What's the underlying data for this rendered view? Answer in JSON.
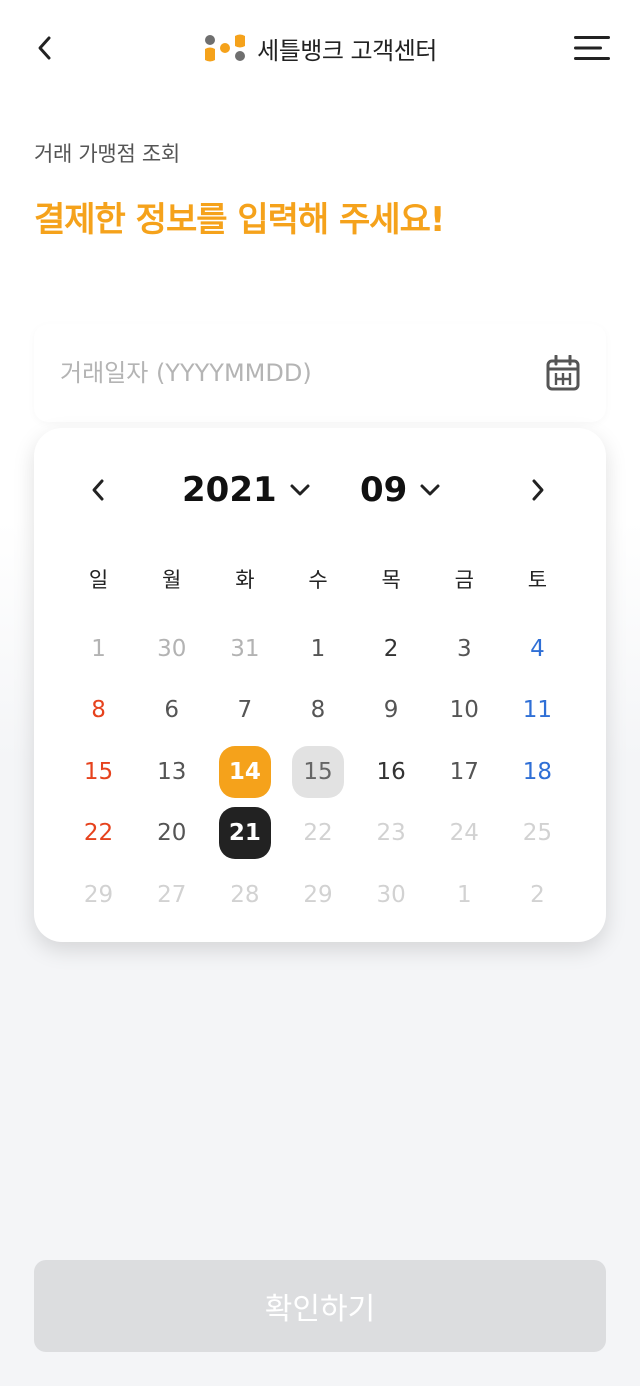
{
  "header": {
    "brand_name": "세틀뱅크 고객센터",
    "icons": {
      "back": "chevron-left-icon",
      "menu": "hamburger-menu-icon",
      "logo": "brand-logo-icon"
    },
    "logo_colors": {
      "orange": "#f5a21b",
      "gray": "#6f6f6f"
    }
  },
  "page": {
    "subtitle": "거래 가맹점 조회",
    "headline": "결제한 정보를 입력해 주세요!"
  },
  "date_field": {
    "value": "",
    "placeholder": "거래일자 (YYYYMMDD)",
    "icon": "calendar-icon"
  },
  "calendar": {
    "year": "2021",
    "month": "09",
    "weekdays": [
      "일",
      "월",
      "화",
      "수",
      "목",
      "금",
      "토"
    ],
    "days": [
      {
        "label": "1",
        "state": "muted"
      },
      {
        "label": "30",
        "state": "muted"
      },
      {
        "label": "31",
        "state": "muted"
      },
      {
        "label": "1",
        "state": "normal"
      },
      {
        "label": "2",
        "state": "strong"
      },
      {
        "label": "3",
        "state": "normal"
      },
      {
        "label": "4",
        "state": "sat"
      },
      {
        "label": "8",
        "state": "sun"
      },
      {
        "label": "6",
        "state": "normal"
      },
      {
        "label": "7",
        "state": "normal"
      },
      {
        "label": "8",
        "state": "normal"
      },
      {
        "label": "9",
        "state": "normal"
      },
      {
        "label": "10",
        "state": "normal"
      },
      {
        "label": "11",
        "state": "sat"
      },
      {
        "label": "15",
        "state": "sun"
      },
      {
        "label": "13",
        "state": "normal"
      },
      {
        "label": "14",
        "state": "selected"
      },
      {
        "label": "15",
        "state": "range"
      },
      {
        "label": "16",
        "state": "strong"
      },
      {
        "label": "17",
        "state": "normal"
      },
      {
        "label": "18",
        "state": "sat"
      },
      {
        "label": "22",
        "state": "sun"
      },
      {
        "label": "20",
        "state": "normal"
      },
      {
        "label": "21",
        "state": "today"
      },
      {
        "label": "22",
        "state": "disabled"
      },
      {
        "label": "23",
        "state": "disabled"
      },
      {
        "label": "24",
        "state": "disabled"
      },
      {
        "label": "25",
        "state": "disabled"
      },
      {
        "label": "29",
        "state": "disabled"
      },
      {
        "label": "27",
        "state": "disabled"
      },
      {
        "label": "28",
        "state": "disabled"
      },
      {
        "label": "29",
        "state": "disabled"
      },
      {
        "label": "30",
        "state": "disabled"
      },
      {
        "label": "1",
        "state": "disabled"
      },
      {
        "label": "2",
        "state": "disabled"
      }
    ],
    "colors": {
      "selected": "#f5a21b",
      "today": "#222222",
      "range": "#e2e2e2",
      "sunday": "#e6421d",
      "saturday": "#2f6fd6"
    }
  },
  "confirm_button": {
    "label": "확인하기",
    "disabled_color": "#dcdddf"
  }
}
